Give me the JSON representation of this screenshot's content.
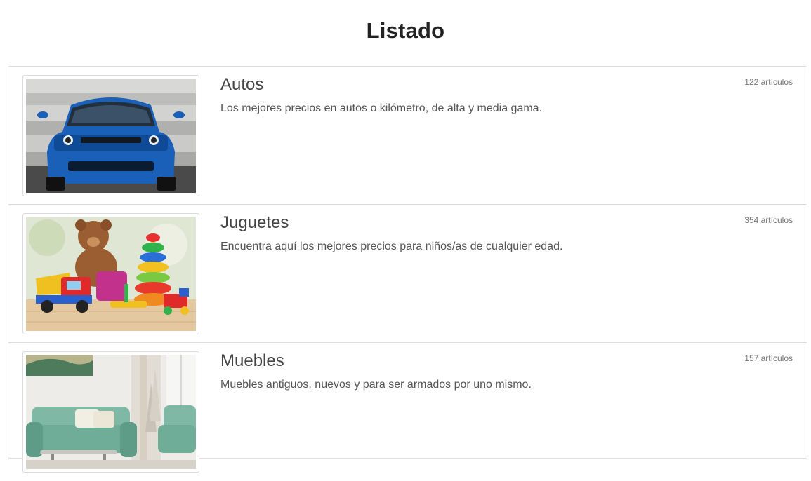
{
  "header": {
    "title": "Listado"
  },
  "items": [
    {
      "title": "Autos",
      "description": "Los mejores precios en autos o kilómetro, de alta y media gama.",
      "count": "122 artículos",
      "image": "blue-sports-car"
    },
    {
      "title": "Juguetes",
      "description": "Encuentra aquí los mejores precios para niños/as de cualquier edad.",
      "count": "354 artículos",
      "image": "teddy-bear-and-toys"
    },
    {
      "title": "Muebles",
      "description": "Muebles antiguos, nuevos y para ser armados por uno mismo.",
      "count": "157 artículos",
      "image": "living-room-sofa"
    }
  ]
}
